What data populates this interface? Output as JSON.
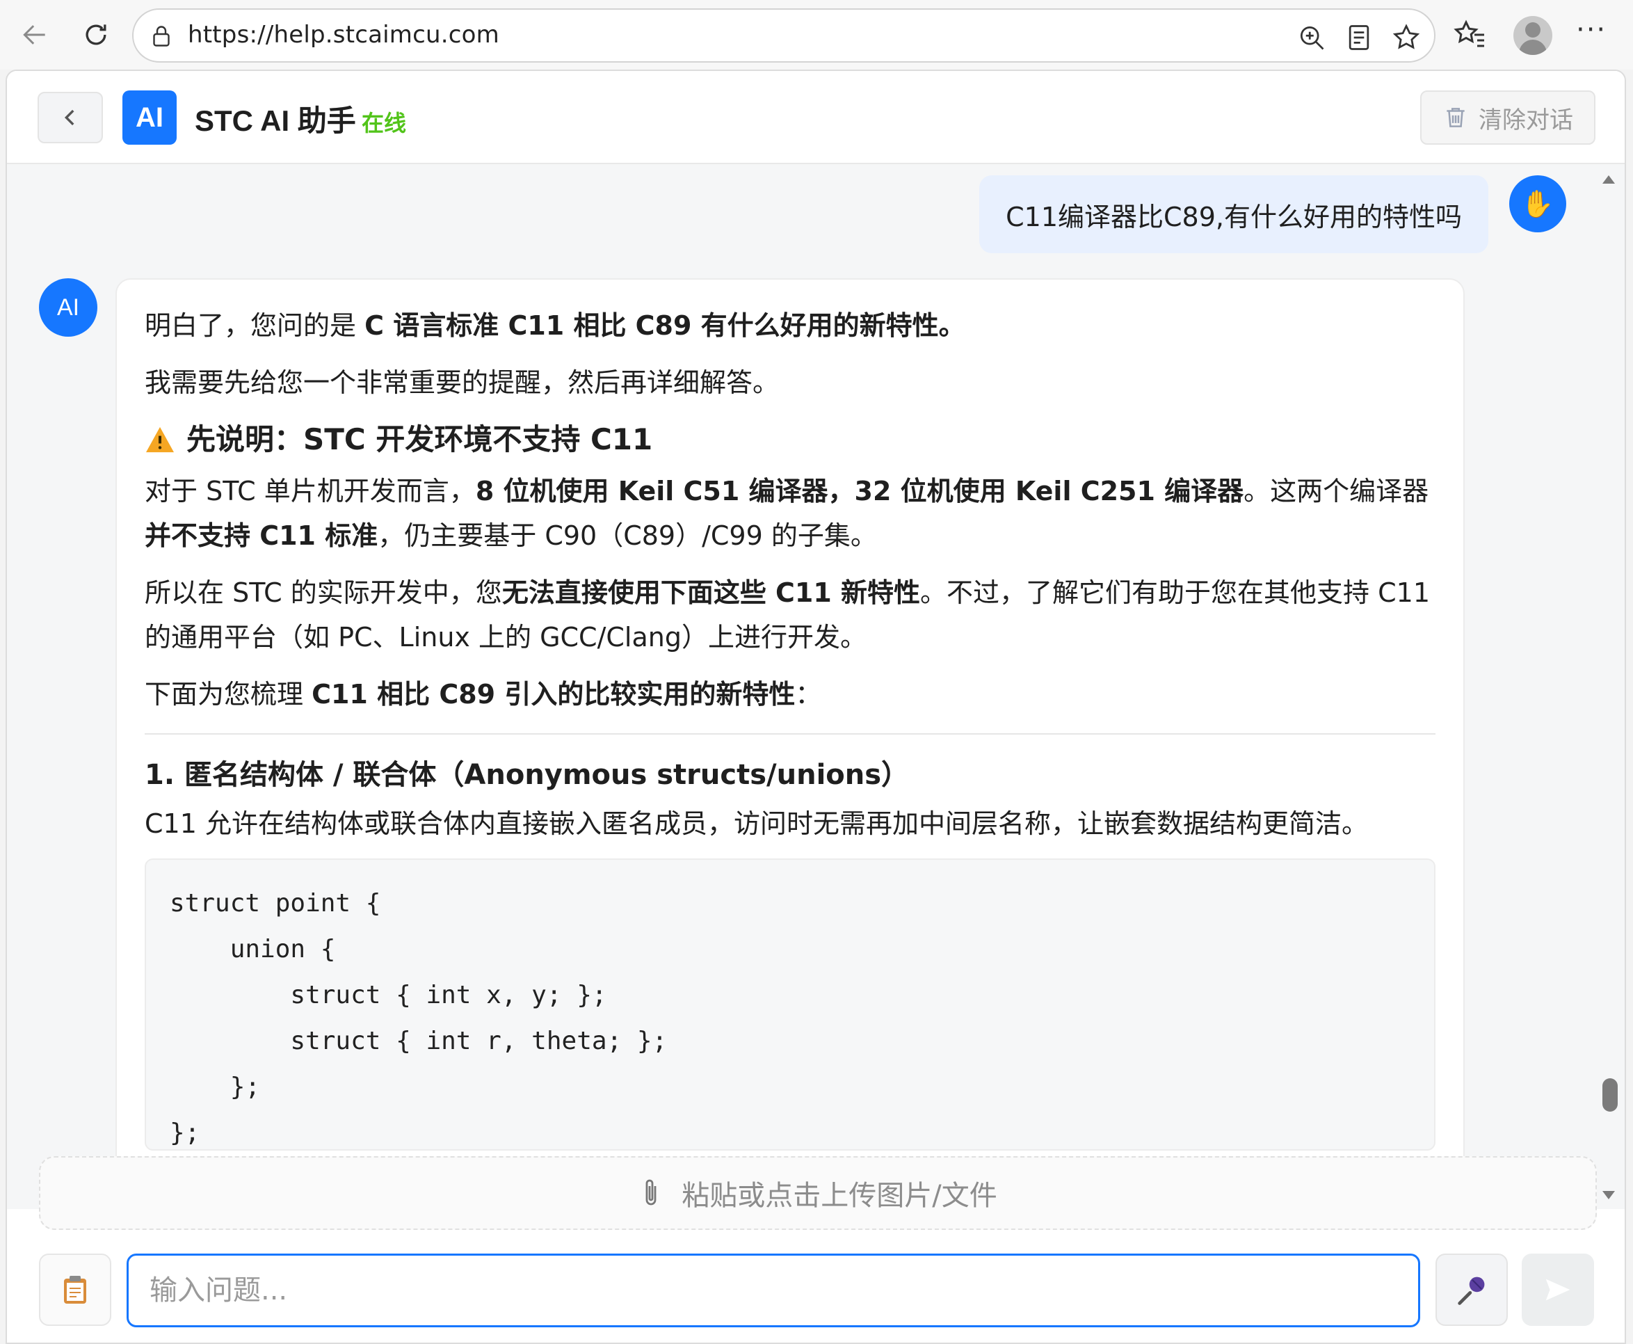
{
  "browser": {
    "url": "https://help.stcaimcu.com"
  },
  "header": {
    "logo_text": "AI",
    "title": "STC AI 助手",
    "status": "在线",
    "clear_label": "清除对话"
  },
  "conversation": {
    "user_message": "C11编译器比C89,有什么好用的特性吗",
    "user_avatar_icon": "hand-icon",
    "ai_avatar_text": "AI",
    "ai_reply": {
      "p1_prefix": "明白了，您问的是 ",
      "p1_bold": "C 语言标准 C11 相比 C89 有什么好用的新特性。",
      "p2": "我需要先给您一个非常重要的提醒，然后再详细解答。",
      "warning_heading": "先说明：STC 开发环境不支持 C11",
      "p3_prefix": "对于 STC 单片机开发而言，",
      "p3_bold1": "8 位机使用 Keil C51 编译器，32 位机使用 Keil C251 编译器",
      "p3_mid": "。这两个编译器",
      "p3_bold2": "并不支持 C11 标准",
      "p3_suffix": "，仍主要基于 C90（C89）/C99 的子集。",
      "p4_prefix": "所以在 STC 的实际开发中，您",
      "p4_bold": "无法直接使用下面这些 C11 新特性",
      "p4_suffix": "。不过，了解它们有助于您在其他支持 C11 的通用平台（如 PC、Linux 上的 GCC/Clang）上进行开发。",
      "p5_prefix": "下面为您梳理 ",
      "p5_bold": "C11 相比 C89 引入的比较实用的新特性",
      "p5_suffix": "：",
      "section1_heading": "1. 匿名结构体 / 联合体（Anonymous structs/unions）",
      "section1_text": "C11 允许在结构体或联合体内直接嵌入匿名成员，访问时无需再加中间层名称，让嵌套数据结构更简洁。",
      "code": "struct point {\n    union {\n        struct { int x, y; };\n        struct { int r, theta; };\n    };\n};"
    }
  },
  "upload": {
    "label": "粘贴或点击上传图片/文件"
  },
  "input": {
    "placeholder": "输入问题...",
    "value": ""
  },
  "colors": {
    "accent": "#1677ff",
    "online": "#52c41a",
    "user_bubble": "#e8f0fe"
  }
}
